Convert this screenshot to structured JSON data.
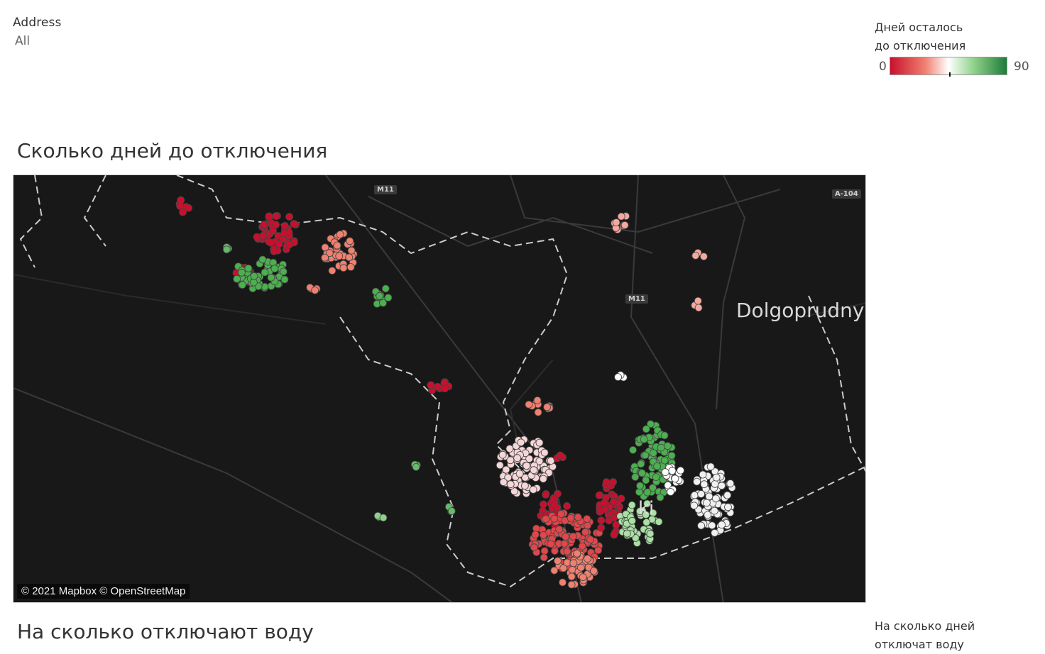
{
  "filter": {
    "label": "Address",
    "value": "All"
  },
  "legend": {
    "title_line1": "Дней осталось",
    "title_line2": "до отключения",
    "min": "0",
    "max": "90",
    "colors": [
      "#c8102e",
      "#f08070",
      "#ffffff",
      "#8fd18a",
      "#1e7b3a"
    ]
  },
  "sections": {
    "map_title": "Сколько дней до отключения",
    "second_title": "На сколько отключают воду",
    "second_legend_line1": "На сколько дней",
    "second_legend_line2": "отключат воду"
  },
  "map": {
    "city_label": "Dolgoprudny",
    "partial_label": "ki",
    "attribution": "© 2021 Mapbox © OpenStreetMap",
    "road_shields": [
      "M11",
      "M11",
      "A-104"
    ]
  }
}
